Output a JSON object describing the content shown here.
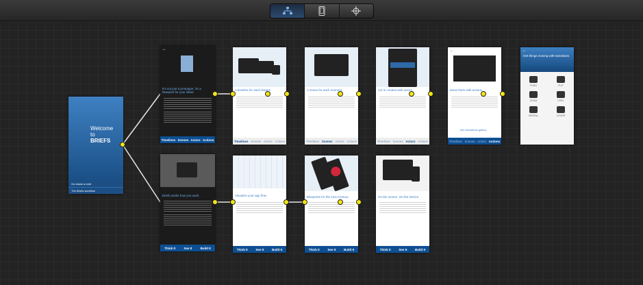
{
  "toolbar": {
    "modes": [
      {
        "icon": "hierarchy-icon",
        "active": true
      },
      {
        "icon": "phone-icon",
        "active": false
      },
      {
        "icon": "crosshair-icon",
        "active": false
      }
    ]
  },
  "start": {
    "title_lines": [
      "Welcome",
      "to",
      "BRIEFS"
    ],
    "menu": [
      "Go inside a brief",
      "The Briefs workflow"
    ]
  },
  "row1": [
    {
      "heading": "It's not just a prototype, it's a blueprint for your ideas",
      "nav": [
        "Timelines",
        "Scenes",
        "Actors",
        "Actions"
      ]
    },
    {
      "heading": "A timeline for each feature",
      "nav": [
        "Timelines",
        "Scenes",
        "Actors",
        "Actions"
      ]
    },
    {
      "heading": "A scene for each moment",
      "nav": [
        "Timelines",
        "Scenes",
        "Actors",
        "Actions"
      ]
    },
    {
      "heading": "Act in context with actors",
      "nav": [
        "Timelines",
        "Scenes",
        "Actors",
        "Actions"
      ]
    },
    {
      "heading": "Move them with actions",
      "link": "see transitions gallery",
      "nav": [
        "Timelines",
        "Scenes",
        "Actors",
        "Actions"
      ]
    },
    {
      "heading": "Get things moving with transitions",
      "tiles": [
        "PUSH",
        "FLIP",
        "ZOOM",
        "CURL",
        "REVEAL",
        "COVER"
      ]
    }
  ],
  "row2": [
    {
      "heading": "Briefs works how you work.",
      "nav": [
        "Think It",
        "See It",
        "Build It"
      ]
    },
    {
      "heading": "Visualize your app flow",
      "nav": [
        "Think It",
        "See It",
        "Build It"
      ]
    },
    {
      "heading": "Blueprints for the 21st Century",
      "nav": [
        "Think It",
        "See It",
        "Build It"
      ]
    },
    {
      "heading": "On the screen. On the Device",
      "nav": [
        "Think It",
        "See It",
        "Build It"
      ]
    }
  ],
  "colors": {
    "accent": "#0e4f93",
    "link": "#3a7fc9",
    "connector": "#f5e612"
  }
}
